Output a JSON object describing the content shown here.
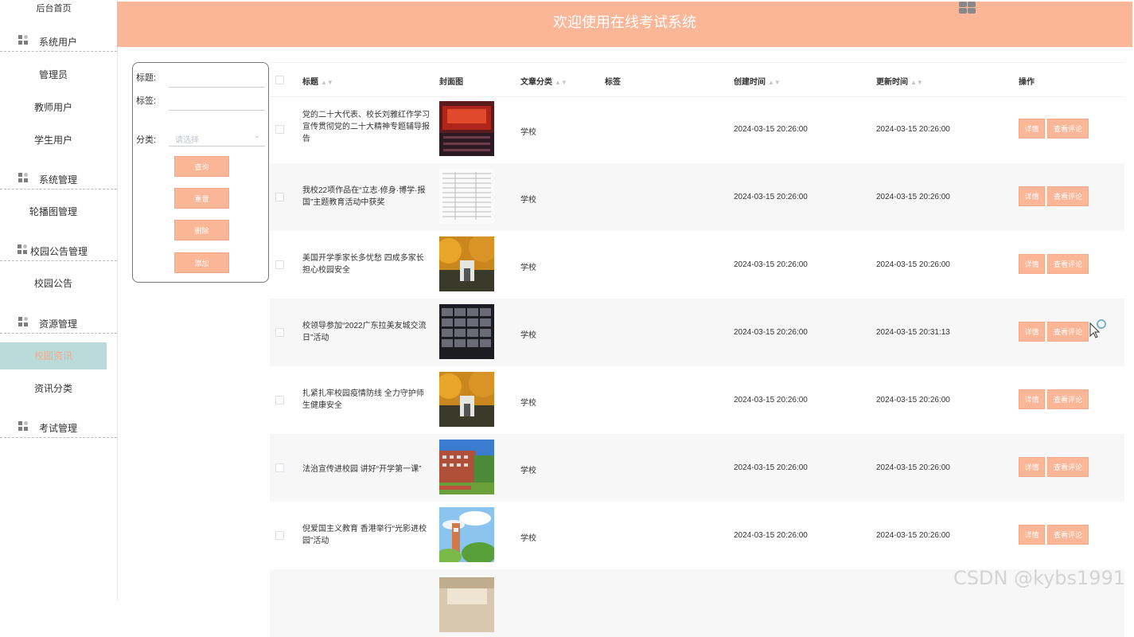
{
  "sidebar": {
    "top_label": "后台首页",
    "groups": [
      {
        "label": "系统用户"
      },
      {
        "label": "系统管理"
      },
      {
        "label": "校园公告管理"
      },
      {
        "label": "资源管理"
      },
      {
        "label": "考试管理"
      }
    ],
    "items": [
      {
        "label": "管理员"
      },
      {
        "label": "教师用户"
      },
      {
        "label": "学生用户"
      },
      {
        "label": "轮播图管理"
      },
      {
        "label": "校园公告"
      },
      {
        "label": "校园资讯"
      },
      {
        "label": "资讯分类"
      }
    ],
    "active_item": "校园资讯"
  },
  "header": {
    "title": "欢迎使用在线考试系统"
  },
  "search": {
    "title_label": "标题:",
    "tag_label": "标签:",
    "category_label": "分类:",
    "category_placeholder": "请选择",
    "query_button": "查询",
    "reset_button": "重置",
    "delete_button": "删除",
    "add_button": "添加"
  },
  "table": {
    "columns": {
      "title": "标题",
      "cover": "封面图",
      "category": "文章分类",
      "tag": "标签",
      "created": "创建时间",
      "updated": "更新时间",
      "actions": "操作"
    },
    "detail_label": "详情",
    "comment_label": "查看评论",
    "rows": [
      {
        "title": "党的二十大代表、校长刘雅红作学习宣传贯彻党的二十大精神专题辅导报告",
        "category": "学校",
        "tag": "",
        "created": "2024-03-15 20:26:00",
        "updated": "2024-03-15 20:26:00",
        "cover": "auditorium"
      },
      {
        "title": "我校22项作品在“立志·修身·博学·报国”主题教育活动中获奖",
        "category": "学校",
        "tag": "",
        "created": "2024-03-15 20:26:00",
        "updated": "2024-03-15 20:26:00",
        "cover": "document"
      },
      {
        "title": "美国开学季家长多忧愁 四成多家长担心校园安全",
        "category": "学校",
        "tag": "",
        "created": "2024-03-15 20:26:00",
        "updated": "2024-03-15 20:26:00",
        "cover": "autumn-campus"
      },
      {
        "title": "校领导参加“2022广东拉美友城交流日”活动",
        "category": "学校",
        "tag": "",
        "created": "2024-03-15 20:26:00",
        "updated": "2024-03-15 20:31:13",
        "cover": "video-conference"
      },
      {
        "title": "扎紧扎牢校园疫情防线 全力守护师生健康安全",
        "category": "学校",
        "tag": "",
        "created": "2024-03-15 20:26:00",
        "updated": "2024-03-15 20:26:00",
        "cover": "autumn-campus"
      },
      {
        "title": "法治宣传进校园 讲好“开学第一课”",
        "category": "学校",
        "tag": "",
        "created": "2024-03-15 20:26:00",
        "updated": "2024-03-15 20:26:00",
        "cover": "campus-building"
      },
      {
        "title": "倪爱国主义教育 香港举行“光影进校园”活动",
        "category": "学校",
        "tag": "",
        "created": "2024-03-15 20:26:00",
        "updated": "2024-03-15 20:26:00",
        "cover": "tower-sky"
      },
      {
        "title": "",
        "category": "",
        "tag": "",
        "created": "",
        "updated": "",
        "cover": "room"
      }
    ]
  },
  "watermark": "CSDN @kybs1991",
  "colors": {
    "accent": "#fbb697",
    "active_bg": "#b9dcdb",
    "active_text": "#f4a98a"
  }
}
